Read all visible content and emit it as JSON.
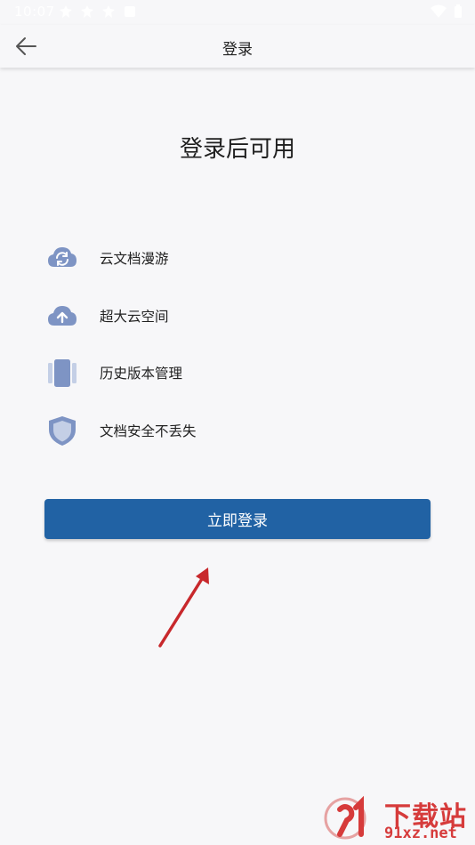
{
  "status_bar": {
    "time": "10:07"
  },
  "app_bar": {
    "title": "登录"
  },
  "headline": "登录后可用",
  "features": [
    {
      "icon": "cloud-sync-icon",
      "label": "云文档漫游"
    },
    {
      "icon": "cloud-upload-icon",
      "label": "超大云空间"
    },
    {
      "icon": "version-history-icon",
      "label": "历史版本管理"
    },
    {
      "icon": "shield-icon",
      "label": "文档安全不丢失"
    }
  ],
  "login_button": {
    "label": "立即登录"
  },
  "watermark": {
    "title": "下载站",
    "url": "91xz.net"
  },
  "colors": {
    "primary": "#2162a4",
    "icon": "#7e94c4",
    "background": "#f7f7f9",
    "arrow": "#c8282c"
  }
}
